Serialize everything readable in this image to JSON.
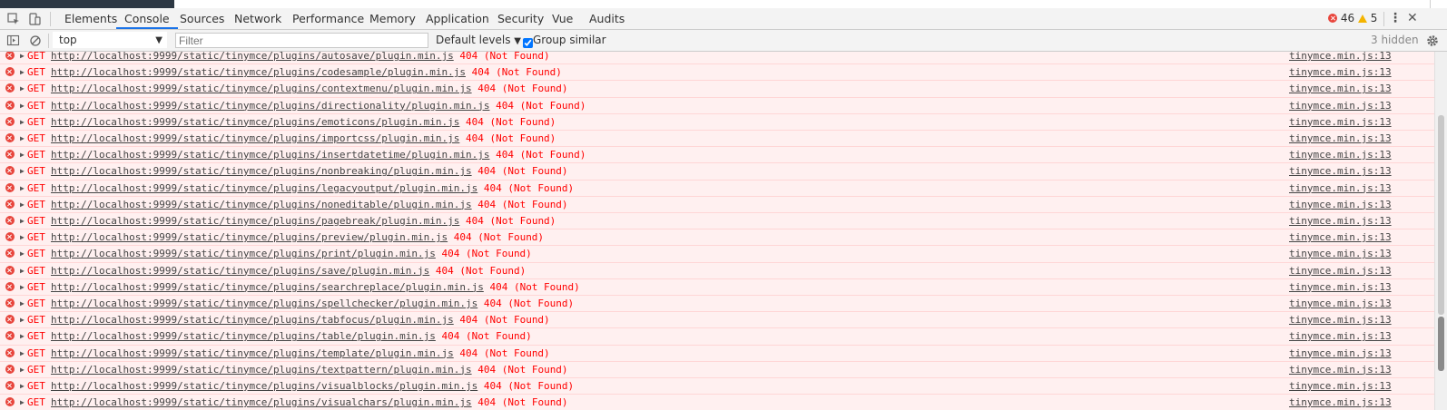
{
  "devtools": {
    "tabs": [
      "Elements",
      "Console",
      "Sources",
      "Network",
      "Performance",
      "Memory",
      "Application",
      "Security",
      "Vue",
      "Audits"
    ],
    "active_tab": "Console",
    "error_count": "46",
    "warning_count": "5",
    "menu_icon": "kebab-menu-icon",
    "close_icon": "close-icon"
  },
  "toolbar": {
    "context": "top",
    "filter_placeholder": "Filter",
    "levels": "Default levels",
    "group_similar": "Group similar",
    "group_similar_checked": true,
    "hidden": "3 hidden"
  },
  "messages": [
    {
      "verb": "GET",
      "url": "http://localhost:9999/static/tinymce/plugins/autosave/plugin.min.js",
      "status": "404 (Not Found)",
      "source": "tinymce.min.js:13"
    },
    {
      "verb": "GET",
      "url": "http://localhost:9999/static/tinymce/plugins/codesample/plugin.min.js",
      "status": "404 (Not Found)",
      "source": "tinymce.min.js:13"
    },
    {
      "verb": "GET",
      "url": "http://localhost:9999/static/tinymce/plugins/contextmenu/plugin.min.js",
      "status": "404 (Not Found)",
      "source": "tinymce.min.js:13"
    },
    {
      "verb": "GET",
      "url": "http://localhost:9999/static/tinymce/plugins/directionality/plugin.min.js",
      "status": "404 (Not Found)",
      "source": "tinymce.min.js:13"
    },
    {
      "verb": "GET",
      "url": "http://localhost:9999/static/tinymce/plugins/emoticons/plugin.min.js",
      "status": "404 (Not Found)",
      "source": "tinymce.min.js:13"
    },
    {
      "verb": "GET",
      "url": "http://localhost:9999/static/tinymce/plugins/importcss/plugin.min.js",
      "status": "404 (Not Found)",
      "source": "tinymce.min.js:13"
    },
    {
      "verb": "GET",
      "url": "http://localhost:9999/static/tinymce/plugins/insertdatetime/plugin.min.js",
      "status": "404 (Not Found)",
      "source": "tinymce.min.js:13"
    },
    {
      "verb": "GET",
      "url": "http://localhost:9999/static/tinymce/plugins/nonbreaking/plugin.min.js",
      "status": "404 (Not Found)",
      "source": "tinymce.min.js:13"
    },
    {
      "verb": "GET",
      "url": "http://localhost:9999/static/tinymce/plugins/legacyoutput/plugin.min.js",
      "status": "404 (Not Found)",
      "source": "tinymce.min.js:13"
    },
    {
      "verb": "GET",
      "url": "http://localhost:9999/static/tinymce/plugins/noneditable/plugin.min.js",
      "status": "404 (Not Found)",
      "source": "tinymce.min.js:13"
    },
    {
      "verb": "GET",
      "url": "http://localhost:9999/static/tinymce/plugins/pagebreak/plugin.min.js",
      "status": "404 (Not Found)",
      "source": "tinymce.min.js:13"
    },
    {
      "verb": "GET",
      "url": "http://localhost:9999/static/tinymce/plugins/preview/plugin.min.js",
      "status": "404 (Not Found)",
      "source": "tinymce.min.js:13"
    },
    {
      "verb": "GET",
      "url": "http://localhost:9999/static/tinymce/plugins/print/plugin.min.js",
      "status": "404 (Not Found)",
      "source": "tinymce.min.js:13"
    },
    {
      "verb": "GET",
      "url": "http://localhost:9999/static/tinymce/plugins/save/plugin.min.js",
      "status": "404 (Not Found)",
      "source": "tinymce.min.js:13"
    },
    {
      "verb": "GET",
      "url": "http://localhost:9999/static/tinymce/plugins/searchreplace/plugin.min.js",
      "status": "404 (Not Found)",
      "source": "tinymce.min.js:13"
    },
    {
      "verb": "GET",
      "url": "http://localhost:9999/static/tinymce/plugins/spellchecker/plugin.min.js",
      "status": "404 (Not Found)",
      "source": "tinymce.min.js:13"
    },
    {
      "verb": "GET",
      "url": "http://localhost:9999/static/tinymce/plugins/tabfocus/plugin.min.js",
      "status": "404 (Not Found)",
      "source": "tinymce.min.js:13"
    },
    {
      "verb": "GET",
      "url": "http://localhost:9999/static/tinymce/plugins/table/plugin.min.js",
      "status": "404 (Not Found)",
      "source": "tinymce.min.js:13"
    },
    {
      "verb": "GET",
      "url": "http://localhost:9999/static/tinymce/plugins/template/plugin.min.js",
      "status": "404 (Not Found)",
      "source": "tinymce.min.js:13"
    },
    {
      "verb": "GET",
      "url": "http://localhost:9999/static/tinymce/plugins/textpattern/plugin.min.js",
      "status": "404 (Not Found)",
      "source": "tinymce.min.js:13"
    },
    {
      "verb": "GET",
      "url": "http://localhost:9999/static/tinymce/plugins/visualblocks/plugin.min.js",
      "status": "404 (Not Found)",
      "source": "tinymce.min.js:13"
    },
    {
      "verb": "GET",
      "url": "http://localhost:9999/static/tinymce/plugins/visualchars/plugin.min.js",
      "status": "404 (Not Found)",
      "source": "tinymce.min.js:13"
    }
  ],
  "colors": {
    "error_text": "#ff0000",
    "error_bg": "#fff0f0",
    "active_tab_underline": "#1a73e8"
  }
}
